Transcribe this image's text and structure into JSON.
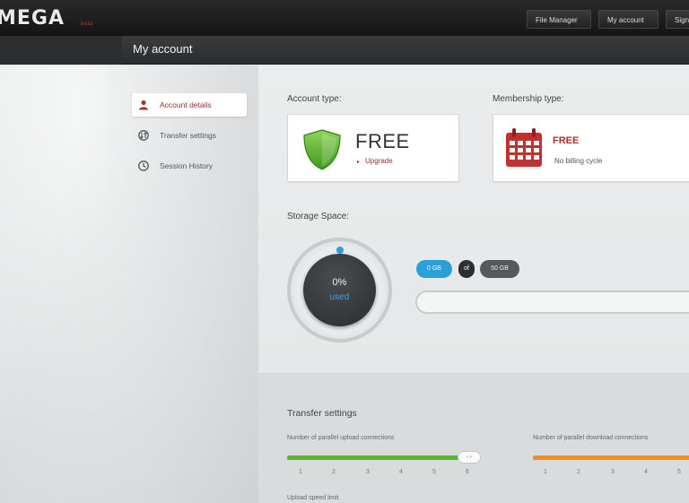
{
  "app": {
    "logo": "MEGA",
    "logo_sub": "beta"
  },
  "topnav": {
    "file_manager": "File Manager",
    "my_account": "My account",
    "sign": "Sign"
  },
  "page": {
    "title": "My account"
  },
  "sidebar": {
    "items": [
      {
        "label": "Account details",
        "icon": "user-icon",
        "active": true
      },
      {
        "label": "Transfer settings",
        "icon": "transfer-icon",
        "active": false
      },
      {
        "label": "Session History",
        "icon": "clock-icon",
        "active": false
      }
    ]
  },
  "account": {
    "type_label": "Account type:",
    "type_value": "FREE",
    "upgrade_label": "Upgrade",
    "membership_label": "Membership type:",
    "membership_value": "FREE",
    "billing_text": "No billing cycle"
  },
  "storage": {
    "label": "Storage Space:",
    "percent": "0%",
    "used_label": "used",
    "used_pill": "0 GB",
    "of_pill": "of",
    "total_pill": "50 GB"
  },
  "transfer": {
    "title": "Transfer settings",
    "upload_label": "Number of parallel upload connections",
    "download_label": "Number of parallel download connections",
    "upload_ticks": [
      "1",
      "2",
      "3",
      "4",
      "5",
      "6"
    ],
    "download_ticks": [
      "1",
      "2",
      "3",
      "4",
      "5"
    ],
    "upload_value": 6,
    "upload_speed_label": "Upload speed limit",
    "handle_glyph": "‹ ›"
  },
  "colors": {
    "accent_red": "#b22c2c",
    "accent_blue": "#2b9fd9",
    "upload_bar": "#5bb532",
    "download_bar": "#f08d2c",
    "shield_green": "#5bb532"
  }
}
